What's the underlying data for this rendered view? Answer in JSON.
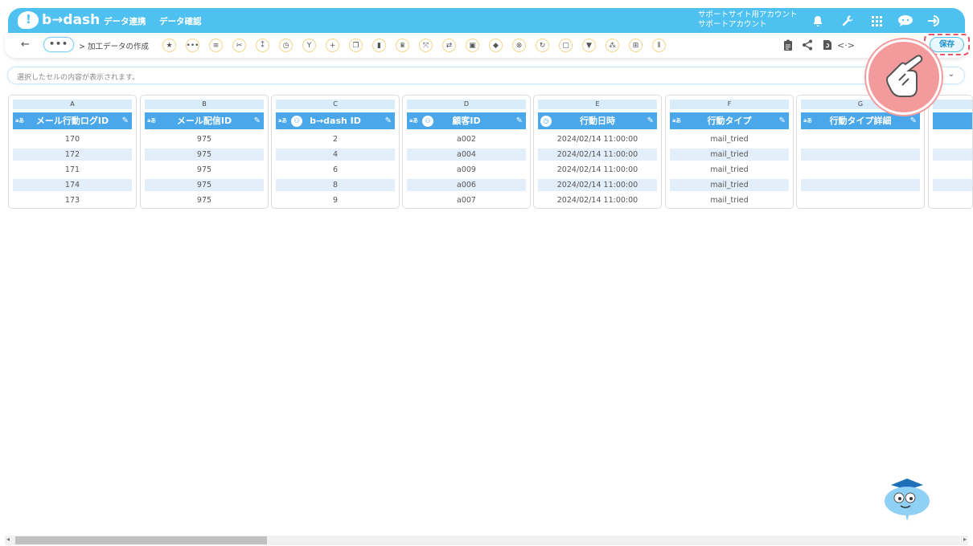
{
  "header": {
    "logo_text": "b→dash",
    "nav": [
      "データ連携",
      "データ確認"
    ],
    "account_line1": "サポートサイト用アカウント",
    "account_line2": "サポートアカウント",
    "icons": [
      "bell-icon",
      "wrench-icon",
      "grid-icon",
      "chat-icon",
      "logout-icon"
    ]
  },
  "toolbar": {
    "back": "←",
    "more": "•••",
    "breadcrumb": "> 加工データの作成",
    "tools": [
      "star-icon",
      "more-icon",
      "list-icon",
      "cut-icon",
      "shuffle-icon",
      "timer-icon",
      "branch-icon",
      "plus-icon",
      "copy-icon",
      "trash-icon",
      "crown-icon",
      "expand-icon",
      "swap-icon",
      "lock-icon",
      "box-icon",
      "cancel-icon",
      "replace-icon",
      "frame-icon",
      "filter-icon",
      "group-icon",
      "table-icon",
      "split-icon"
    ],
    "right_icons": [
      "clipboard-icon",
      "share-icon",
      "refresh-icon",
      "code-icon"
    ],
    "save_label": "保存"
  },
  "cellbar": {
    "placeholder": "選択したセルの内容が表示されます。"
  },
  "columns": [
    {
      "letter": "A",
      "title": "メール行動ログID",
      "type": "text",
      "rows": [
        "170",
        "172",
        "171",
        "174",
        "173"
      ]
    },
    {
      "letter": "B",
      "title": "メール配信ID",
      "type": "text",
      "rows": [
        "975",
        "975",
        "975",
        "975",
        "975"
      ]
    },
    {
      "letter": "C",
      "title": "b→dash ID",
      "type": "people",
      "rows": [
        "2",
        "4",
        "6",
        "8",
        "9"
      ]
    },
    {
      "letter": "D",
      "title": "顧客ID",
      "type": "people",
      "rows": [
        "a002",
        "a004",
        "a009",
        "a006",
        "a007"
      ]
    },
    {
      "letter": "E",
      "title": "行動日時",
      "type": "timer",
      "rows": [
        "2024/02/14 11:00:00",
        "2024/02/14 11:00:00",
        "2024/02/14 11:00:00",
        "2024/02/14 11:00:00",
        "2024/02/14 11:00:00"
      ]
    },
    {
      "letter": "F",
      "title": "行動タイプ",
      "type": "text",
      "rows": [
        "mail_tried",
        "mail_tried",
        "mail_tried",
        "mail_tried",
        "mail_tried"
      ]
    },
    {
      "letter": "G",
      "title": "行動タイプ詳細",
      "type": "text",
      "rows": [
        "",
        "",
        "",
        "",
        ""
      ]
    }
  ],
  "colors": {
    "header_bg": "#4fc1f1",
    "column_header_bg": "#4aa7ea",
    "alt_row_bg": "#e2eef9",
    "highlight": "#e8556a"
  }
}
